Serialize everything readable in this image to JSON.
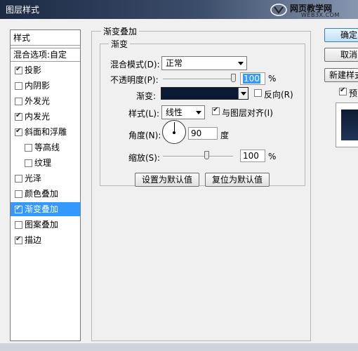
{
  "window": {
    "title": "图层样式",
    "watermark_line1": "网页教学网",
    "watermark_line2": "WEB3X.COM"
  },
  "style_list": {
    "header": "样式",
    "blend_options": "混合选项:自定",
    "items": [
      {
        "label": "投影",
        "checked": true
      },
      {
        "label": "内阴影",
        "checked": false
      },
      {
        "label": "外发光",
        "checked": false
      },
      {
        "label": "内发光",
        "checked": true
      },
      {
        "label": "斜面和浮雕",
        "checked": true
      },
      {
        "label": "等高线",
        "checked": false
      },
      {
        "label": "纹理",
        "checked": false
      },
      {
        "label": "光泽",
        "checked": false
      },
      {
        "label": "颜色叠加",
        "checked": false
      },
      {
        "label": "渐变叠加",
        "checked": true,
        "selected": true
      },
      {
        "label": "图案叠加",
        "checked": false
      },
      {
        "label": "描边",
        "checked": true
      }
    ]
  },
  "gradient_overlay": {
    "section_title": "渐变叠加",
    "subsection_title": "渐变",
    "blend_mode_label": "混合模式(D):",
    "blend_mode_value": "正常",
    "opacity_label": "不透明度(P):",
    "opacity_value": "100",
    "opacity_unit": "%",
    "gradient_label": "渐变:",
    "gradient_color": "#0b1a33",
    "reverse_label": "反向(R)",
    "reverse_checked": false,
    "style_label": "样式(L):",
    "style_value": "线性",
    "align_label": "与图层对齐(I)",
    "align_checked": true,
    "angle_label": "角度(N):",
    "angle_value": "90",
    "angle_unit": "度",
    "scale_label": "缩放(S):",
    "scale_value": "100",
    "scale_unit": "%",
    "set_default_button": "设置为默认值",
    "reset_default_button": "复位为默认值"
  },
  "right_buttons": {
    "ok": "确定",
    "cancel": "取消",
    "new_style": "新建样式...",
    "preview_label": "预览",
    "preview_checked": true
  },
  "colors": {
    "selection": "#3399ff",
    "dialog_bg": "#f0f0f0",
    "gradient_dark": "#0b1a33"
  }
}
